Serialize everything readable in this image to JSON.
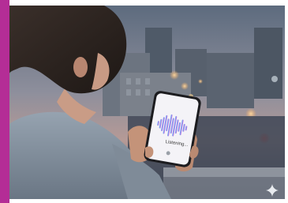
{
  "phone": {
    "status_text": "Listening..."
  },
  "colors": {
    "accent_bar": "#b42d96",
    "waveform_blue": "#6fa6f0",
    "waveform_pink": "#e07ad0"
  },
  "icons": {
    "watermark": "sparkle-icon"
  }
}
